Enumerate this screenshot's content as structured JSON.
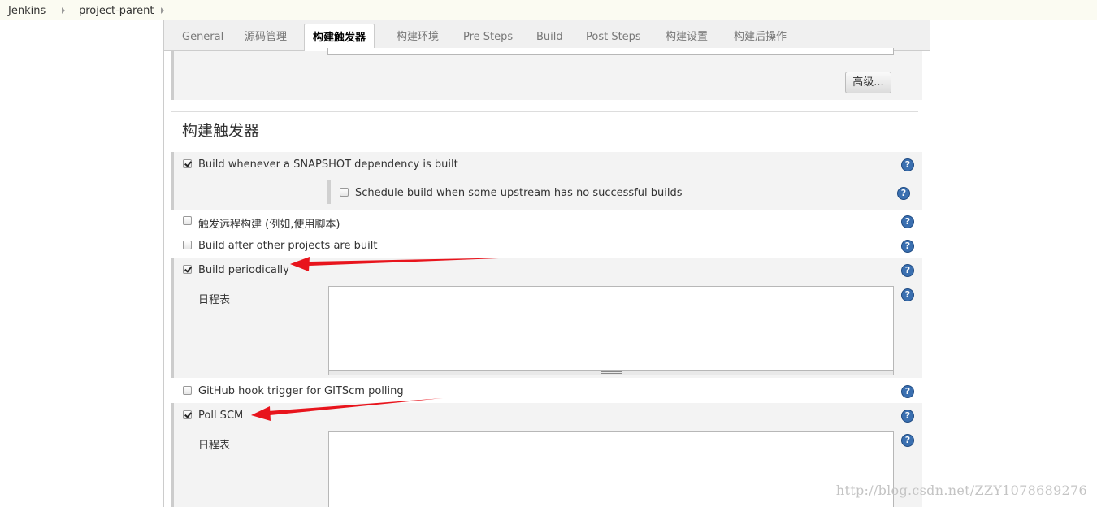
{
  "breadcrumb": {
    "items": [
      "Jenkins",
      "project-parent"
    ]
  },
  "tabs": [
    "General",
    "源码管理",
    "构建触发器",
    "构建环境",
    "Pre Steps",
    "Build",
    "Post Steps",
    "构建设置",
    "构建后操作"
  ],
  "active_tab": "构建触发器",
  "advanced_button": "高级...",
  "section_title": "构建触发器",
  "triggers": {
    "snapshot": {
      "label": "Build whenever a SNAPSHOT dependency is built",
      "checked": true
    },
    "upstream": {
      "label": "Schedule build when some upstream has no successful builds",
      "checked": false
    },
    "remote": {
      "label": "触发远程构建 (例如,使用脚本)",
      "checked": false
    },
    "after_other": {
      "label": "Build after other projects are built",
      "checked": false
    },
    "periodically": {
      "label": "Build periodically",
      "checked": true
    },
    "github_hook": {
      "label": "GitHub hook trigger for GITScm polling",
      "checked": false
    },
    "poll_scm": {
      "label": "Poll SCM",
      "checked": true
    }
  },
  "schedule_label": "日程表",
  "periodic_schedule_value": "",
  "poll_schedule_value": "",
  "help_glyph": "?",
  "watermark": "http://blog.csdn.net/ZZY1078689276",
  "colors": {
    "arrow": "#e8141c",
    "help": "#3a6fb0",
    "section_bg": "#f3f3f3"
  }
}
